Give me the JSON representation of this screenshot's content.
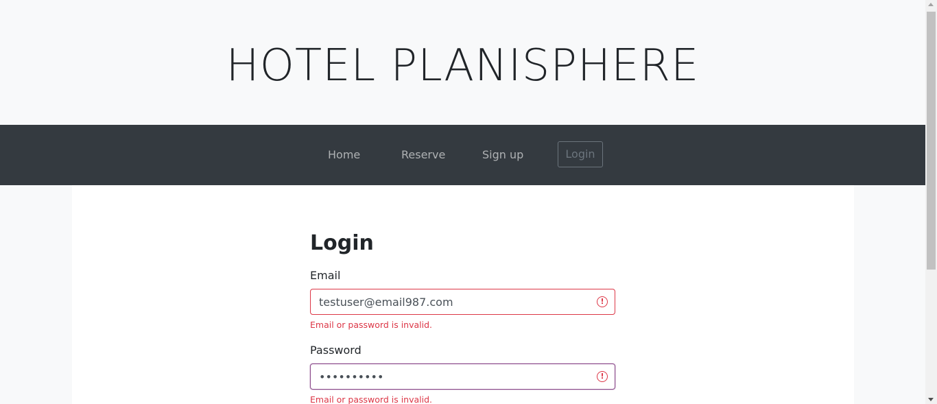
{
  "header": {
    "brand": "HOTEL PLANISPHERE"
  },
  "nav": {
    "items": [
      {
        "label": "Home"
      },
      {
        "label": "Reserve"
      },
      {
        "label": "Sign up"
      }
    ],
    "login_label": "Login"
  },
  "form": {
    "title": "Login",
    "email": {
      "label": "Email",
      "value": "testuser@email987.com",
      "error": "Email or password is invalid."
    },
    "password": {
      "label": "Password",
      "value": "••••••••••",
      "error": "Email or password is invalid."
    }
  },
  "icons": {
    "invalid": "exclamation-circle-icon"
  },
  "colors": {
    "navbar": "#343a40",
    "error": "#dc3545",
    "background": "#f8f9fa"
  }
}
